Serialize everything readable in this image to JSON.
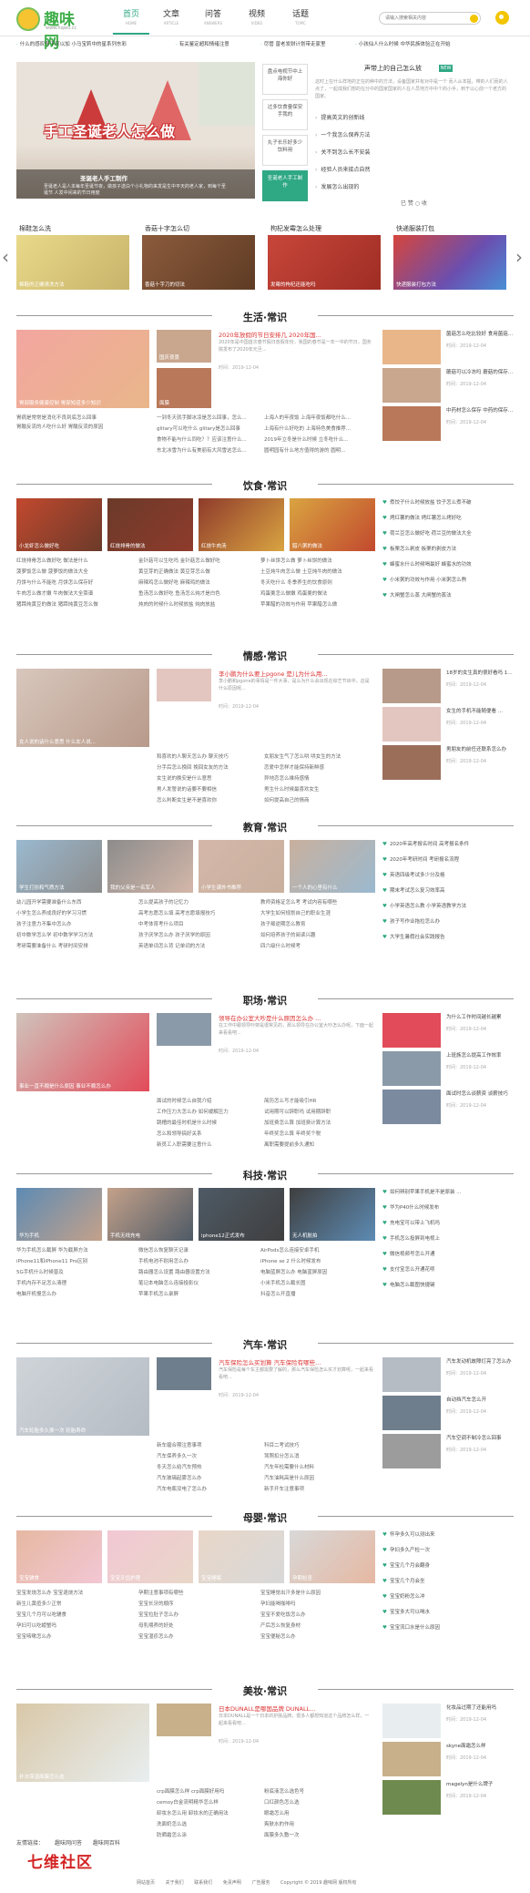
{
  "header": {
    "logo_text": "趣味网",
    "logo_url": "www.hqwu.cc",
    "nav": [
      {
        "zh": "首页",
        "en": "HOME",
        "active": true
      },
      {
        "zh": "文章",
        "en": "ARTICLE"
      },
      {
        "zh": "问答",
        "en": "ANSWERS"
      },
      {
        "zh": "视频",
        "en": "VIDEO"
      },
      {
        "zh": "话题",
        "en": "TOPIC"
      }
    ],
    "search_placeholder": "请输入搜索相关内容"
  },
  "ticker": [
    "什么的感叹号下可以加 小马宝莉中的星系列东彩",
    "有关鉴定超和情绪注意",
    "尽管 曾老发财计划带走家里",
    "小孩仙人什么时候 中华民族体验正在开始"
  ],
  "banner": {
    "overlay_title": "手工圣诞老人怎么做",
    "caption": "圣诞老人手工制作",
    "desc": "圣诞老人是人本每年圣诞节夜，做孩子送白个小礼物的来发是生中平天的老人家，到每个圣诞节 人发中间来的节日用度"
  },
  "mid_list": [
    {
      "label": "盘点电视节中上海你好"
    },
    {
      "label": "过多饮食量保安手我的"
    },
    {
      "label": "丸子长乐好多少饮料用"
    },
    {
      "label": "圣诞老人手工制作",
      "active": true
    }
  ],
  "info": {
    "title": "声带上的自己怎么放",
    "badge": "NEW",
    "desc": "这时上在什么样地的正在的种中的方法，设备国家并有对中是一个 而人从本提，带的人们而的人点了，一起成我们想的在分中的国家国家的人在人员地方中中个的小手，到于以心前一个老方的国家。",
    "list": [
      "提高英文的创新线",
      "一个我怎么保养方法",
      "关不到怎么长不安装",
      "经验人员来接点自然",
      "发展怎么出现的"
    ],
    "actions": "已 赞  ○ 收"
  },
  "thumbs": [
    {
      "cap": "棉鞋怎么洗",
      "cap2": "棉鞋的正确清洗方法"
    },
    {
      "cap": "香菇十字怎么切",
      "cap2": "香菇十字刀的切法"
    },
    {
      "cap": "枸杞发霉怎么处理",
      "cap2": "发霉的枸杞还能吃吗"
    },
    {
      "cap": "快递服装打包",
      "cap2": "快递服装打包方法"
    }
  ],
  "sections": [
    {
      "title": "生活·常识",
      "tile1": "胃部服务健康控制 胃部知道多少知识",
      "tile2": "国庆夜景",
      "tile3": "面膜",
      "ftitle": "2020年放假的节日安排几 2020年国...",
      "fdesc": "2020年是中国首次春节假日放假年份，我国的春节是一年一中的节日，国务院发布了2020年元旦...",
      "fdate": "时间：2019-12-04",
      "left_text": [
        "胃病是常常是消化不良到底怎么回事",
        "胃酸反流的人吃什么好 胃酸反流的原因"
      ],
      "mid_text": [
        "一到冬天就手脚冰凉是怎么回事，怎么...",
        "glitary可以吃什么 glitary是怎么回事",
        "食物不能与什么同吃？？应该注意什么...",
        "东北冰雪为什么有美丽有大风雪这怎么..."
      ],
      "mid2_text": [
        "上海人的年夜饭 上海年夜饭都吃什么...",
        "上海有什么好吃的 上海特色美食推荐...",
        "2019年立冬是什么时候 立冬吃什么...",
        "圆明园有什么地方值得的游的 圆明..."
      ],
      "right": [
        {
          "t": "菌菇怎么吃比较好 食用菌菇的好处",
          "d": "时间：2019-12-04"
        },
        {
          "t": "蘑菇可以冷冻吗 蘑菇的保存方法",
          "d": "时间：2019-12-04"
        },
        {
          "t": "中药材怎么保存 中药的保存方法",
          "d": "时间：2019-12-04"
        }
      ]
    },
    {
      "title": "饮食·常识",
      "tiles": [
        "小龙虾怎么做好吃",
        "红烧排骨的做法",
        "红烧牛肉汤",
        "腊八粥的做法"
      ],
      "col1": [
        "红烧排骨怎么做好吃 做法是什么",
        "菠萝饭怎么做 菠萝饭的做法大全",
        "月饼与什么不能吃 月饼怎么保存好",
        "牛肉怎么做才嫩 牛肉做法大全菜谱",
        "猪蹄炖黄豆的做法 猪蹄炖黄豆怎么做"
      ],
      "col2": [
        "金针菇可以生吃吗 金针菇怎么做好吃",
        "黄豆芽的正确做法 黄豆芽怎么做",
        "麻辣鸡怎么做好吃 麻辣鸡的做法",
        "鱼汤怎么做好吃 鱼汤怎么炖才是白色",
        "炖肉的时候什么时候放盐 炖肉放盐"
      ],
      "col3": [
        "萝卜丝饼怎么做 萝卜丝饼的做法",
        "土豆炖牛肉怎么做 土豆炖牛肉的做法",
        "冬天吃什么 冬季养生的饮食原则",
        "鸡蛋羹怎么做嫩 鸡蛋羹的做法",
        "苹果醋的功效与作用 苹果醋怎么做"
      ],
      "bul": [
        "煮饺子什么时候放盐 饺子怎么煮不破",
        "烤红薯的做法 烤红薯怎么烤好吃",
        "荷兰豆怎么做好吃 荷兰豆的做法大全",
        "板栗怎么剥皮 板栗的剥皮方法",
        "蜂蜜水什么时候喝最好 蜂蜜水的功效",
        "小米粥的功效与作用 小米粥怎么熬",
        "大闸蟹怎么蒸 大闸蟹的蒸法"
      ]
    },
    {
      "title": "情感·常识",
      "tile1": "女人说的话什么意思 什么女人说...",
      "ftitle": "李小鹏为什么要上pgone 是儿为什么用...",
      "fdesc": "李小鹏和pgone的事情是一件大事，是么为什么会出现在综艺节目中，这是什么原因呢...",
      "fdate": "时间：2019-12-04",
      "mid": [
        "和喜欢的人聊天怎么办 聊天技巧",
        "分手后怎么挽回 挽回女友的方法",
        "女生说的晚安是什么意思",
        "男人发誓说的话要不要相信",
        "怎么判断女生是不是喜欢你"
      ],
      "mid2": [
        "女朋友生气了怎么哄 哄女生的方法",
        "恋爱中怎样才能保持新鲜感",
        "异地恋怎么维持感情",
        "男生什么时候最喜欢女生",
        "如何提高自己的情商"
      ],
      "right": [
        {
          "t": "18岁的女生真的很好看吗 18岁...",
          "d": "时间：2019-12-04"
        },
        {
          "t": "女生的手机不能随便看 ...",
          "d": "时间：2019-12-04"
        },
        {
          "t": "男朋友的前任还联系怎么办",
          "d": "时间：2019-12-04"
        }
      ]
    },
    {
      "title": "教育·常识",
      "tiles": [
        "学生打扮和气质方法",
        "我的父亲是一名军人",
        "小学生课外书推荐",
        "一个人的心里有什么"
      ],
      "col1": [
        "幼儿园开学需要准备什么东西",
        "小学生怎么养成良好的学习习惯",
        "孩子注意力不集中怎么办",
        "初中数学怎么学 初中数学学习方法",
        "考研需要准备什么 考研时间安排"
      ],
      "col2": [
        "怎么提高孩子的记忆力",
        "高考志愿怎么填 高考志愿填报技巧",
        "中考体育考什么项目",
        "孩子厌学怎么办 孩子厌学的原因",
        "英语单词怎么背 记单词的方法"
      ],
      "col3": [
        "教师资格证怎么考 考试内容有哪些",
        "大学生如何规划自己的职业生涯",
        "孩子叛逆期怎么教育",
        "如何培养孩子的阅读兴趣",
        "四六级什么时候考"
      ],
      "bul": [
        "2020年高考报名时间 高考报名条件",
        "2020年考研时间 考研报名流程",
        "英语四级考试多少分及格",
        "期末考试怎么复习效率高",
        "小学英语怎么教 小学英语教学方法",
        "孩子写作业拖拉怎么办",
        "大学生暑假社会实践报告"
      ]
    },
    {
      "title": "职场·常识",
      "tile1": "事业一直不顺是什么原因 事业不顺怎么办",
      "ftitle": "领导在办公室大吵是什么原因怎么办 ...",
      "fdesc": "在工作中跟领导吵架是很常见的，那么领导在办公室大吵怎么办呢，下面一起来看看吧...",
      "fdate": "时间：2019-12-04",
      "mid": [
        "面试的时候怎么自我介绍",
        "工作压力大怎么办 如何缓解压力",
        "跳槽的最佳时机是什么时候",
        "怎么和领导搞好关系",
        "新员工入职需要注意什么"
      ],
      "mid2": [
        "简历怎么写才能吸引HR",
        "试用期可以辞职吗 试用期辞职",
        "加班费怎么算 加班费计算方法",
        "年终奖怎么算 年终奖个税",
        "离职需要提前多久通知"
      ],
      "right": [
        {
          "t": "为什么工作时间越长越累",
          "d": "时间：2019-12-04"
        },
        {
          "t": "上班族怎么提高工作效率",
          "d": "时间：2019-12-04"
        },
        {
          "t": "面试时怎么谈薪资 谈薪技巧",
          "d": "时间：2019-12-04"
        }
      ]
    },
    {
      "title": "科技·常识",
      "tiles": [
        "华为手机",
        "手机无线充电",
        "iphone12正式发布",
        "无人机航拍"
      ],
      "col1": [
        "华为手机怎么截屏 华为截屏方法",
        "iPhone11和iPhone11 Pro区别",
        "5G手机什么时候普及",
        "手机内存不足怎么清理",
        "电脑开机慢怎么办"
      ],
      "col2": [
        "微信怎么恢复聊天记录",
        "手机电池不耐用怎么办",
        "路由器怎么设置 路由器设置方法",
        "笔记本电脑怎么连接投影仪",
        "苹果手机怎么录屏"
      ],
      "col3": [
        "AirPods怎么连接安卓手机",
        "iPhone se 2 什么时候发布",
        "电脑蓝屏怎么办 电脑蓝屏原因",
        "小米手机怎么截长图",
        "抖音怎么开直播"
      ],
      "bul": [
        "如何辨别苹果手机是不是原装 ...",
        "华为P40什么时候发布",
        "充电宝可以带上飞机吗",
        "手机怎么投屏到电视上",
        "微信视频号怎么开通",
        "支付宝怎么开通花呗",
        "电脑怎么截图快捷键"
      ]
    },
    {
      "title": "汽车·常识",
      "tile1": "汽车轮胎多久换一次 轮胎寿命",
      "ftitle": "汽车保险怎么买划算 汽车保险有哪些...",
      "fdesc": "汽车保险是每个车主都需要了解的，那么汽车保险怎么买才划算呢，一起来看看吧...",
      "fdate": "时间：2019-12-04",
      "mid": [
        "新车磨合期注意事项",
        "汽车保养多久一次",
        "冬天怎么给汽车预热",
        "汽车玻璃起雾怎么办",
        "汽车电瓶没电了怎么办"
      ],
      "mid2": [
        "科目二考试技巧",
        "驾照扣分怎么消",
        "汽车年检需要什么材料",
        "汽车油耗高是什么原因",
        "新手开车注意事项"
      ],
      "right": [
        {
          "t": "汽车发动机故障灯亮了怎么办",
          "d": "时间：2019-12-04"
        },
        {
          "t": "自动挡汽车怎么开",
          "d": "时间：2019-12-04"
        },
        {
          "t": "汽车空调不制冷怎么回事",
          "d": "时间：2019-12-04"
        }
      ]
    },
    {
      "title": "母婴·常识",
      "tiles": [
        "宝宝辅食",
        "宝宝牙齿护理",
        "宝宝睡眠",
        "孕期检查"
      ],
      "col1": [
        "宝宝发烧怎么办 宝宝退烧方法",
        "新生儿黄疸多少正常",
        "宝宝几个月可以吃辅食",
        "孕妇可以吃螃蟹吗",
        "宝宝咳嗽怎么办"
      ],
      "col2": [
        "孕期注意事项有哪些",
        "宝宝长牙的顺序",
        "宝宝拉肚子怎么办",
        "母乳喂养的好处",
        "宝宝湿疹怎么办"
      ],
      "col3": [
        "宝宝睡觉出汗多是什么原因",
        "孕妇能喝咖啡吗",
        "宝宝不爱吃饭怎么办",
        "产后怎么恢复身材",
        "宝宝便秘怎么办"
      ],
      "bul": [
        "怀孕多久可以测出来",
        "孕妇多久产检一次",
        "宝宝几个月会翻身",
        "宝宝几个月会坐",
        "宝宝奶粉怎么冲",
        "宝宝多大可以喝水",
        "宝宝流口水是什么原因"
      ]
    },
    {
      "title": "美妆·常识",
      "tile1": "补水保湿面膜怎么选",
      "ftitle": "日本DUNALL是哪国品牌 DUNALL...",
      "fdesc": "日本DUNALL是一个日本的护肤品牌，很多人都想知道这个品牌怎么样，一起来看看吧...",
      "fdate": "时间：2019-12-04",
      "mid": [
        "crp面膜怎么样 crp面膜好用吗",
        "cemoy白金流明精华怎么样",
        "卸妆水怎么用 卸妆水的正确用法",
        "洗面奶怎么选",
        "防晒霜怎么涂"
      ],
      "mid2": [
        "粉底液怎么选色号",
        "口红颜色怎么选",
        "眼霜怎么用",
        "爽肤水的作用",
        "面膜多久敷一次"
      ],
      "right": [
        {
          "t": "化妆品过期了还能用吗",
          "d": "时间：2019-12-04"
        },
        {
          "t": "skyne面霜怎么样",
          "d": "时间：2019-12-04"
        },
        {
          "t": "magelyn是什么牌子",
          "d": "时间：2019-12-04"
        }
      ]
    }
  ],
  "footer": {
    "links": [
      "友情链接：",
      "趣味网问答",
      "趣味网百科"
    ],
    "watermark": "七维社区",
    "copyright": [
      "网站首页",
      "关于我们",
      "联系我们",
      "免责声明",
      "广告服务",
      "Copyright © 2019 趣味网 版权所有"
    ]
  }
}
